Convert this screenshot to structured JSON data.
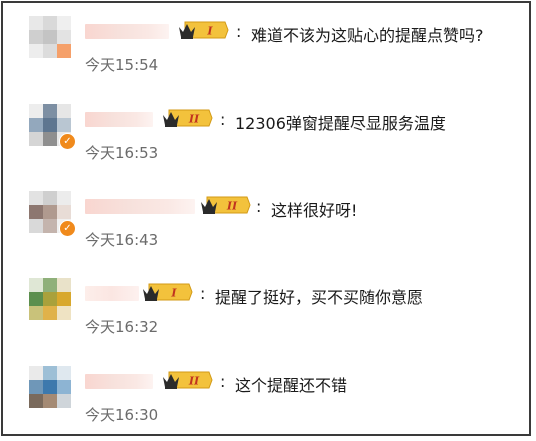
{
  "comments": [
    {
      "text": "难道不该为这贴心的提醒点赞吗?",
      "time": "今天15:54",
      "badge_level": "I",
      "verified": false,
      "avatar_colors": [
        "#e8e8e8",
        "#d9d9d9",
        "#efefef",
        "#cfcfcf",
        "#c4c4c4",
        "#e3e3e3",
        "#ededed",
        "#dcdcdc",
        "#f5a06a"
      ]
    },
    {
      "text": "12306弹窗提醒尽显服务温度",
      "time": "今天16:53",
      "badge_level": "II",
      "verified": true,
      "avatar_colors": [
        "#ededed",
        "#7d8fa3",
        "#e6e6e6",
        "#93a8bd",
        "#5e7690",
        "#b9c6d2",
        "#d5d5d5",
        "#8f8f8f",
        "#e9e9e9"
      ]
    },
    {
      "text": "这样很好呀!",
      "time": "今天16:43",
      "badge_level": "II",
      "verified": true,
      "avatar_colors": [
        "#e2e2e2",
        "#cfcfcf",
        "#ececec",
        "#8d7770",
        "#b09a8f",
        "#e8dcd6",
        "#d9d9d9",
        "#c4b4ad",
        "#f0f0f0"
      ]
    },
    {
      "text": "提醒了挺好，买不买随你意愿",
      "time": "今天16:32",
      "badge_level": "I",
      "verified": false,
      "avatar_colors": [
        "#dfe7d5",
        "#8fb07a",
        "#e9e2c9",
        "#5c8f4e",
        "#a9a13c",
        "#d8a82d",
        "#c9c27a",
        "#e0b24a",
        "#efe3c3"
      ]
    },
    {
      "text": "这个提醒还不错",
      "time": "今天16:30",
      "badge_level": "II",
      "verified": false,
      "avatar_colors": [
        "#eaeaea",
        "#9dbfd6",
        "#dfe8ef",
        "#6f97b8",
        "#3d79ad",
        "#8db4d3",
        "#7a6a5c",
        "#a48a74",
        "#cfd5da"
      ]
    }
  ],
  "colors": {
    "frame": "#3a3a3a",
    "time": "#6b6b6b",
    "badge_gold": "#f3c23c",
    "crown": "#2b2b2b",
    "verified": "#f08a1c"
  }
}
